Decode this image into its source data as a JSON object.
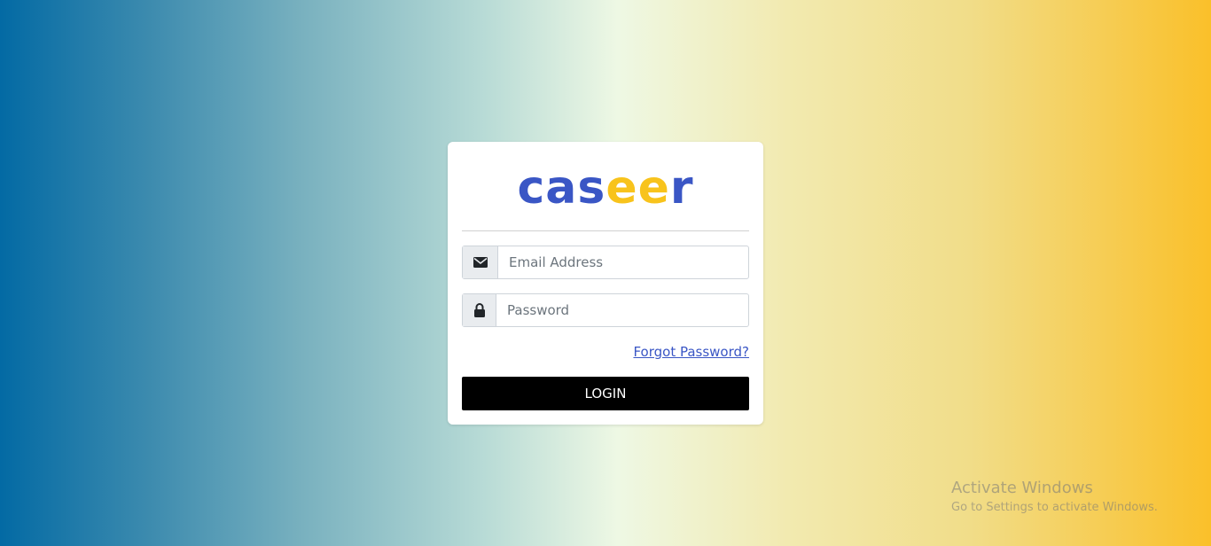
{
  "logo": {
    "part1": "cas",
    "part2": "ee",
    "part3": "r",
    "colors": {
      "primary": "#3a56c5",
      "accent": "#f8c31c"
    }
  },
  "form": {
    "email": {
      "placeholder": "Email Address",
      "value": "",
      "icon": "envelope-icon"
    },
    "password": {
      "placeholder": "Password",
      "value": "",
      "icon": "lock-icon"
    },
    "forgot_label": "Forgot Password?",
    "login_label": "LOGIN"
  },
  "watermark": {
    "title": "Activate Windows",
    "subtitle": "Go to Settings to activate Windows."
  },
  "colors": {
    "button_bg": "#000000",
    "link": "#3a56c5",
    "gradient_left": "#036aa4",
    "gradient_right": "#fac02a"
  }
}
